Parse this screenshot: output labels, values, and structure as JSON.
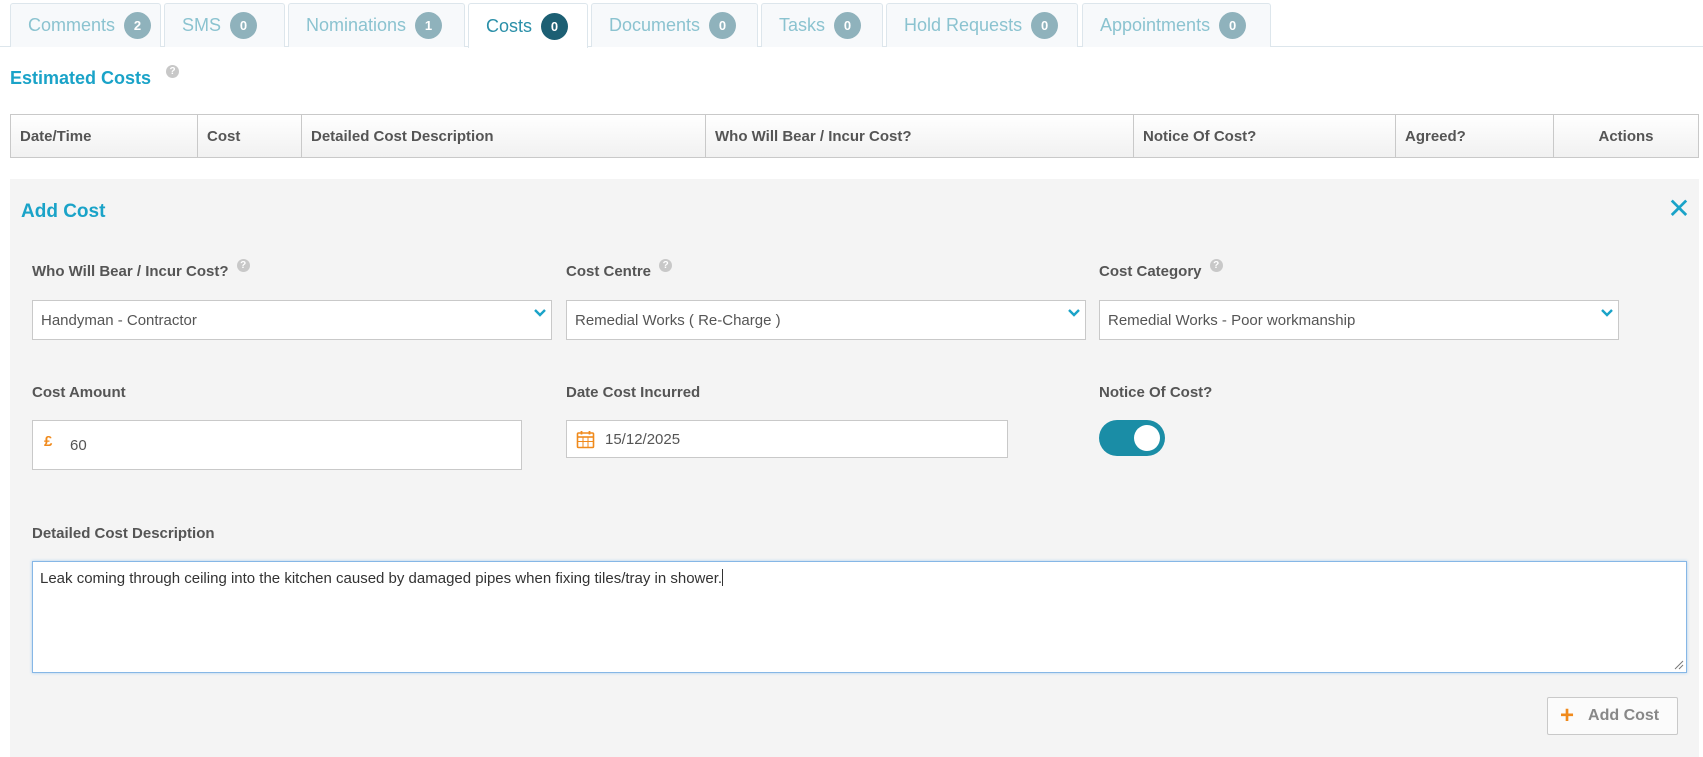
{
  "tabs": [
    {
      "label": "Comments",
      "count": "2"
    },
    {
      "label": "SMS",
      "count": "0"
    },
    {
      "label": "Nominations",
      "count": "1"
    },
    {
      "label": "Costs",
      "count": "0",
      "active": true
    },
    {
      "label": "Documents",
      "count": "0"
    },
    {
      "label": "Tasks",
      "count": "0"
    },
    {
      "label": "Hold Requests",
      "count": "0"
    },
    {
      "label": "Appointments",
      "count": "0"
    }
  ],
  "estimated_costs": {
    "title": "Estimated Costs",
    "help": "?",
    "columns": [
      "Date/Time",
      "Cost",
      "Detailed Cost Description",
      "Who Will Bear / Incur Cost?",
      "Notice Of Cost?",
      "Agreed?",
      "Actions"
    ]
  },
  "add_cost": {
    "title": "Add Cost",
    "who_bears": {
      "label": "Who Will Bear / Incur Cost?",
      "help": "?",
      "value": "Handyman - Contractor"
    },
    "cost_centre": {
      "label": "Cost Centre",
      "help": "?",
      "value": "Remedial Works ( Re-Charge )"
    },
    "cost_category": {
      "label": "Cost Category",
      "help": "?",
      "value": "Remedial Works - Poor workmanship"
    },
    "cost_amount": {
      "label": "Cost Amount",
      "currency": "£",
      "value": "60"
    },
    "date_incurred": {
      "label": "Date Cost Incurred",
      "value": "15/12/2025"
    },
    "notice_of_cost": {
      "label": "Notice Of Cost?",
      "enabled": true
    },
    "description": {
      "label": "Detailed Cost Description",
      "value": "Leak coming through ceiling into the kitchen caused by damaged pipes when fixing tiles/tray in shower."
    },
    "submit_label": "Add Cost",
    "submit_icon": "+"
  },
  "colors": {
    "accent": "#1aa3c8",
    "toggle_on": "#1a8da6",
    "orange": "#f08a1c"
  },
  "icons": [
    "help-icon",
    "close-icon",
    "chevron-down-icon",
    "calendar-icon",
    "plus-icon"
  ]
}
